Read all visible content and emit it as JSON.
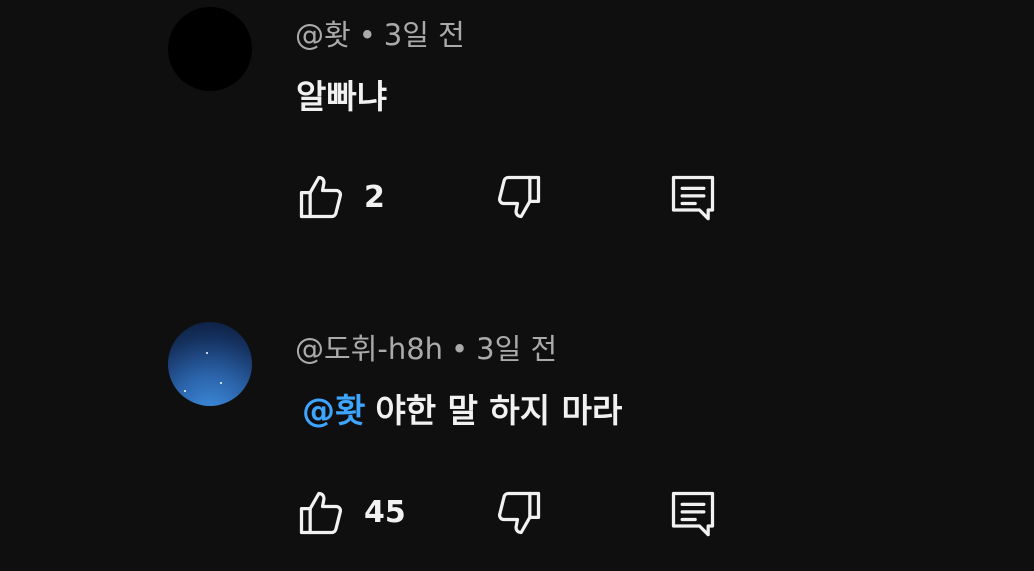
{
  "comments": [
    {
      "author": "@홧",
      "separator": "•",
      "time": "3일 전",
      "text": "알빠냐",
      "mention": "",
      "likes": "2",
      "avatar_style": "black"
    },
    {
      "author": "@도휘-h8h",
      "separator": "•",
      "time": "3일 전",
      "mention": "@홧",
      "text": "야한 말 하지 마라",
      "likes": "45",
      "avatar_style": "night-sky"
    }
  ],
  "colors": {
    "background": "#0f0f0f",
    "meta": "#aaaaaa",
    "text": "#f1f1f1",
    "mention": "#3ea6ff"
  },
  "icons": {
    "like": "thumbs-up-icon",
    "dislike": "thumbs-down-icon",
    "reply": "reply-comment-icon"
  }
}
